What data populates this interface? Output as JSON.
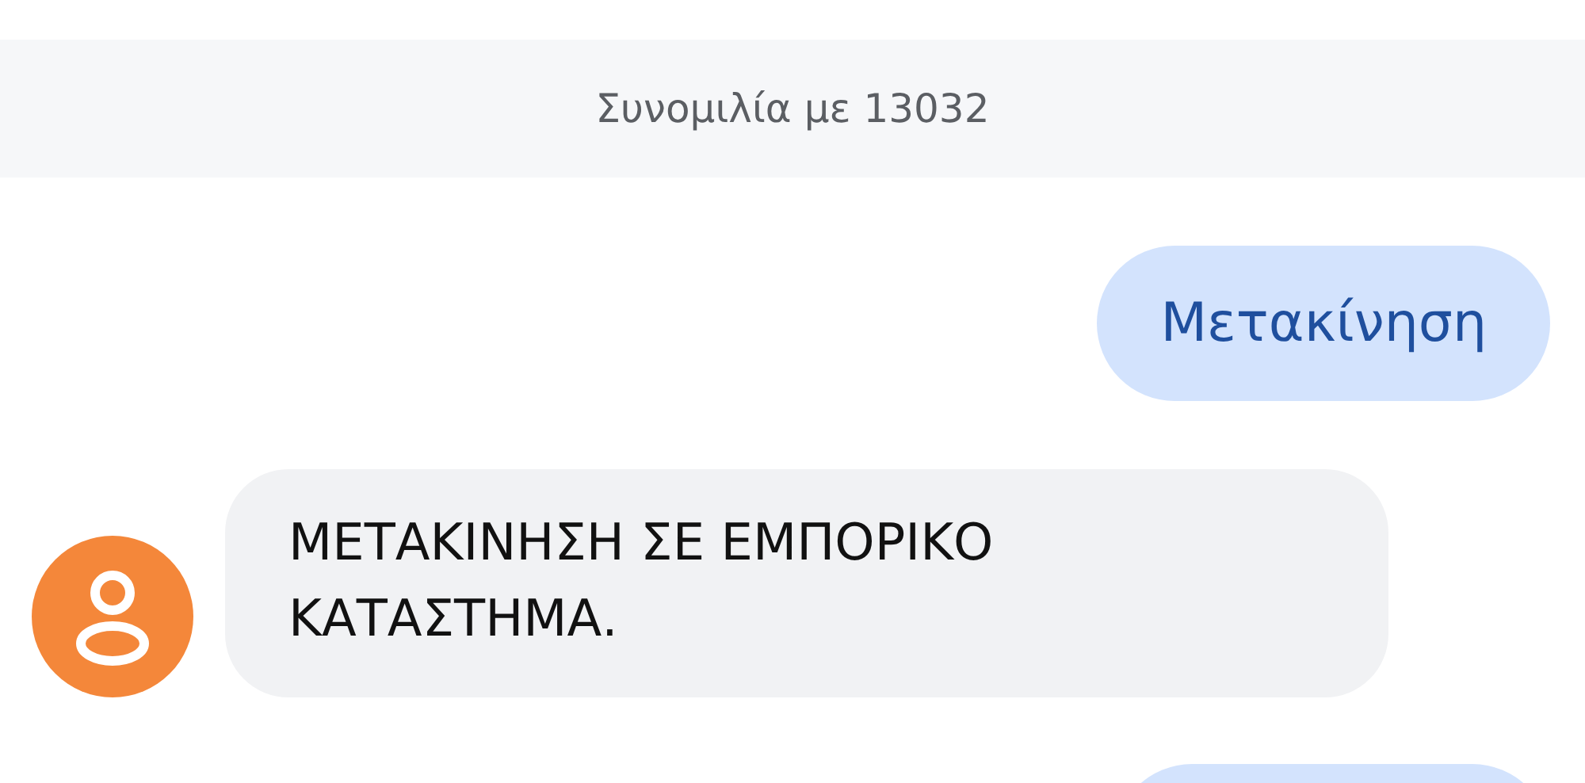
{
  "conversation_header": {
    "title": "Συνομιλία με 13032"
  },
  "messages": [
    {
      "kind": "sent",
      "text": "Μετακίνηση"
    },
    {
      "kind": "received",
      "text": "ΜΕΤΑΚΙΝΗΣΗ ΣΕ ΕΜΠΟΡΙΚΟ ΚΑΤΑΣΤΗΜΑ."
    },
    {
      "kind": "sent"
    }
  ]
}
